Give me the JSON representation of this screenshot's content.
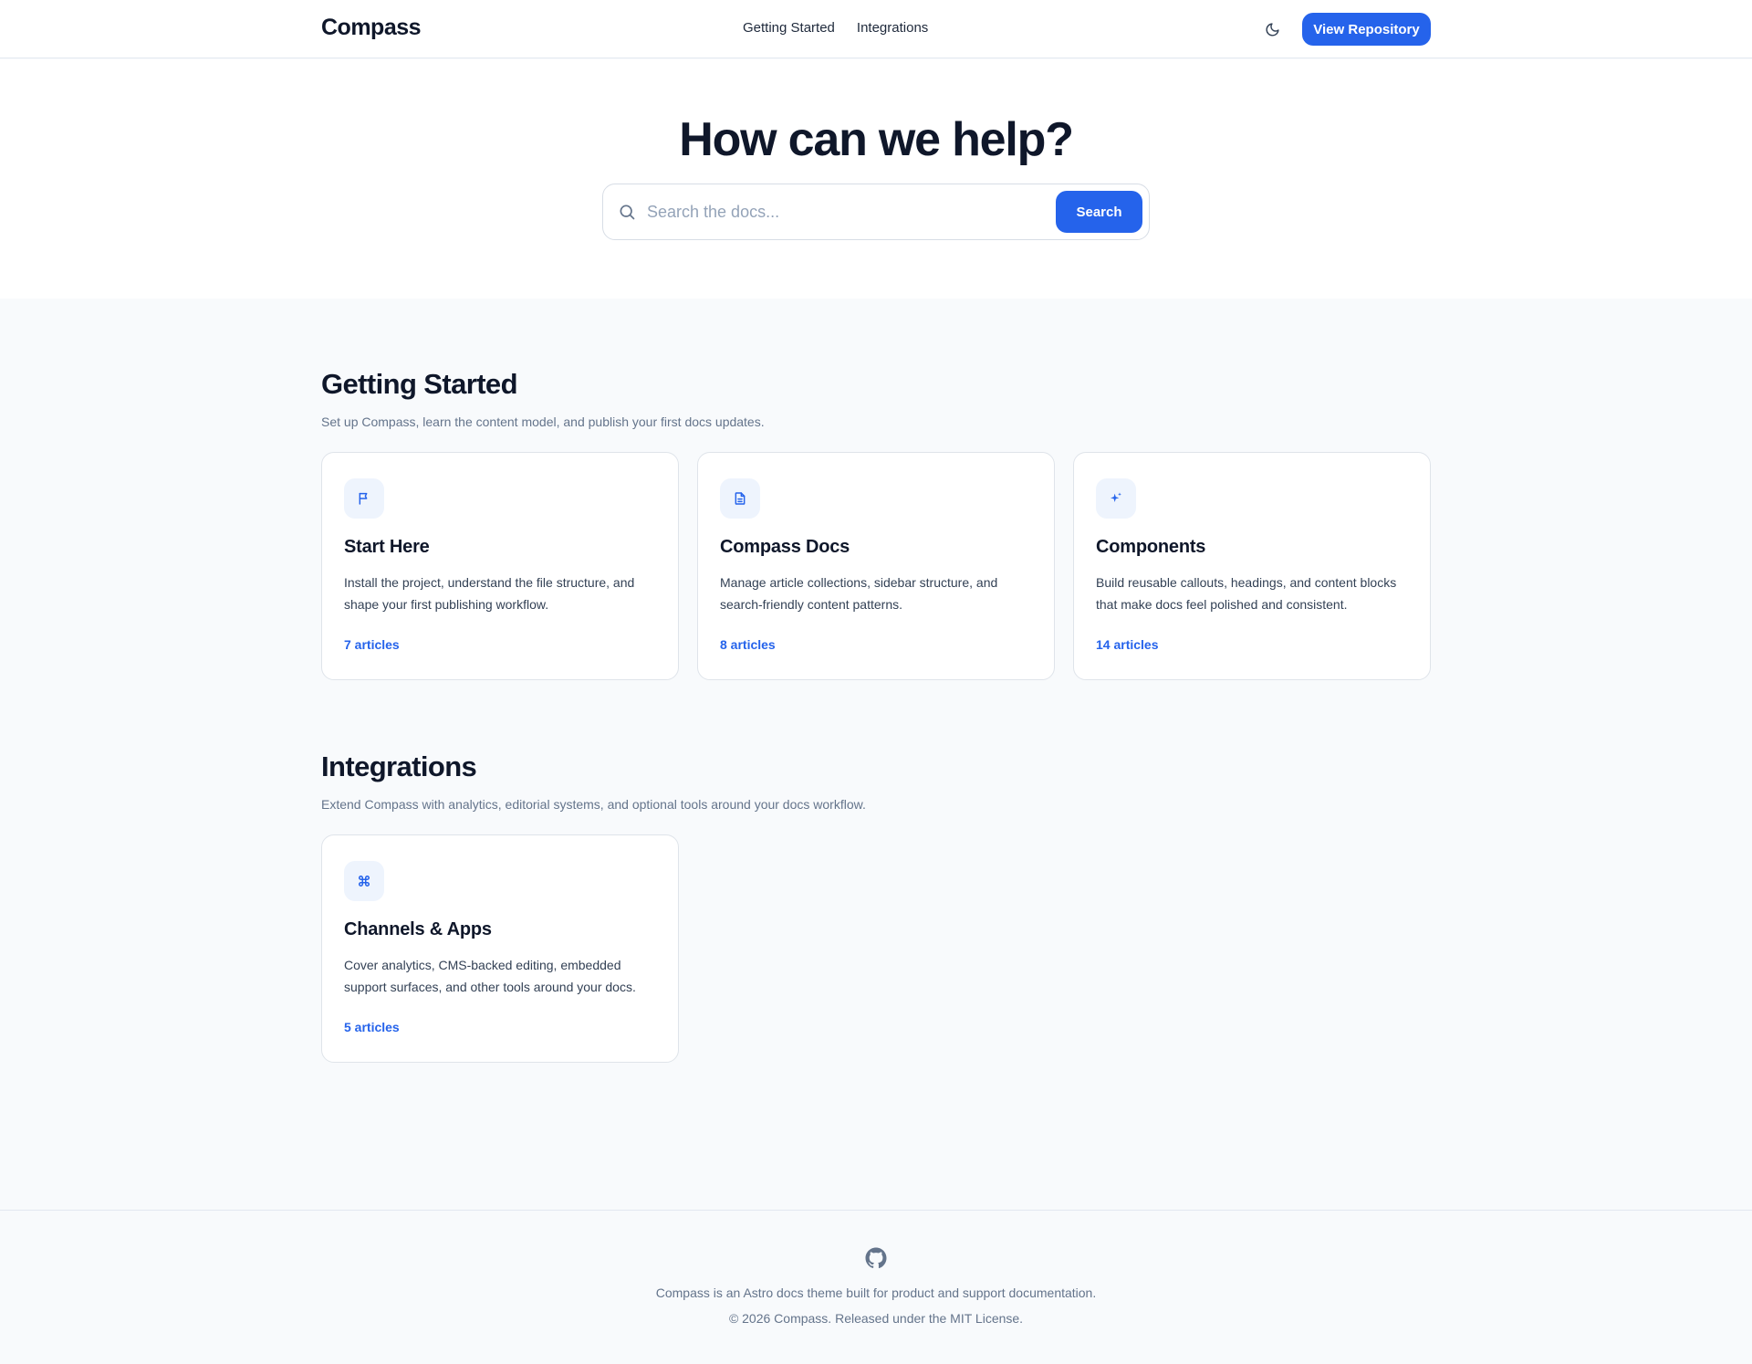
{
  "header": {
    "logo": "Compass",
    "nav": [
      "Getting Started",
      "Integrations"
    ],
    "theme_toggle_icon": "moon-icon",
    "repo_button": "View Repository"
  },
  "hero": {
    "title": "How can we help?",
    "search_placeholder": "Search the docs...",
    "search_value": "",
    "search_button": "Search"
  },
  "sections": [
    {
      "title": "Getting Started",
      "subtitle": "Set up Compass, learn the content model, and publish your first docs updates.",
      "cards": [
        {
          "icon": "flag-icon",
          "title": "Start Here",
          "description": "Install the project, understand the file structure, and shape your first publishing workflow.",
          "count": "7 articles"
        },
        {
          "icon": "file-text-icon",
          "title": "Compass Docs",
          "description": "Manage article collections, sidebar structure, and search-friendly content patterns.",
          "count": "8 articles"
        },
        {
          "icon": "sparkle-icon",
          "title": "Components",
          "description": "Build reusable callouts, headings, and content blocks that make docs feel polished and consistent.",
          "count": "14 articles"
        }
      ]
    },
    {
      "title": "Integrations",
      "subtitle": "Extend Compass with analytics, editorial systems, and optional tools around your docs workflow.",
      "cards": [
        {
          "icon": "command-icon",
          "title": "Channels & Apps",
          "description": "Cover analytics, CMS-backed editing, embedded support surfaces, and other tools around your docs.",
          "count": "5 articles"
        }
      ]
    }
  ],
  "footer": {
    "icon": "github-icon",
    "line1": "Compass is an Astro docs theme built for product and support documentation.",
    "line2": "© 2026 Compass. Released under the MIT License."
  },
  "colors": {
    "accent": "#2563eb",
    "text": "#0f172a",
    "muted": "#64748b",
    "page_bg": "#f8fafc",
    "icon_bg": "#eef4fd"
  }
}
